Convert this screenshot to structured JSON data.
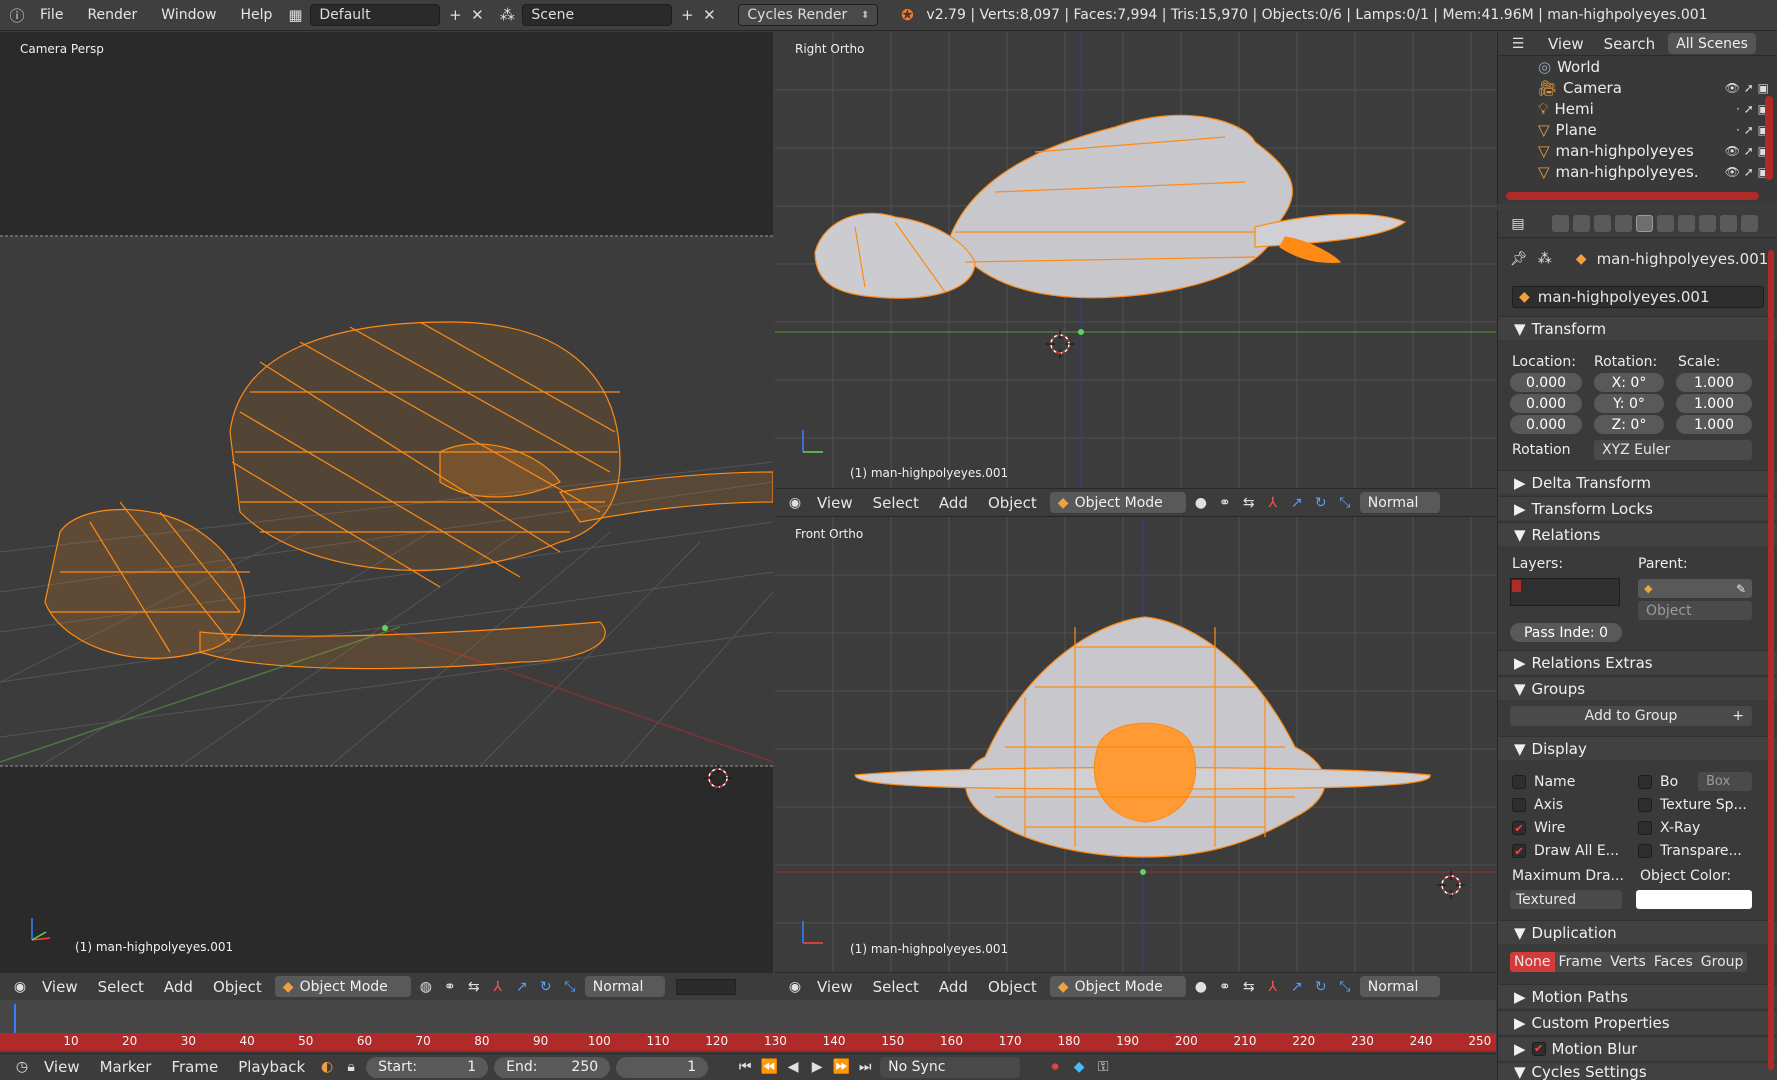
{
  "topbar": {
    "menus": [
      "File",
      "Render",
      "Window",
      "Help"
    ],
    "layout": "Default",
    "scene": "Scene",
    "engine": "Cycles Render",
    "stats": "v2.79 | Verts:8,097 | Faces:7,994 | Tris:15,970 | Objects:0/6 | Lamps:0/1 | Mem:41.96M | man-highpolyeyes.001"
  },
  "viewports": {
    "camera": {
      "label": "Camera Persp",
      "object": "(1) man-highpolyeyes.001"
    },
    "right": {
      "label": "Right Ortho",
      "object": "(1) man-highpolyeyes.001"
    },
    "front": {
      "label": "Front Ortho",
      "object": "(1) man-highpolyeyes.001"
    }
  },
  "vp_header": {
    "view": "View",
    "select": "Select",
    "add": "Add",
    "object": "Object",
    "mode": "Object Mode",
    "orientation": "Normal"
  },
  "timeline": {
    "ticks": [
      "10",
      "20",
      "30",
      "40",
      "50",
      "60",
      "70",
      "80",
      "90",
      "100",
      "110",
      "120",
      "130",
      "140",
      "150",
      "160",
      "170",
      "180",
      "190",
      "200",
      "210",
      "220",
      "230",
      "240",
      "250"
    ],
    "menus": [
      "View",
      "Marker",
      "Frame",
      "Playback"
    ],
    "start_label": "Start:",
    "start": "1",
    "end_label": "End:",
    "end": "250",
    "current": "1",
    "sync": "No Sync"
  },
  "outliner": {
    "tabs": [
      "View",
      "Search",
      "All Scenes"
    ],
    "items": [
      {
        "name": "World",
        "icon": "world-icon"
      },
      {
        "name": "Camera",
        "icon": "camera-icon"
      },
      {
        "name": "Hemi",
        "icon": "lamp-icon"
      },
      {
        "name": "Plane",
        "icon": "mesh-icon"
      },
      {
        "name": "man-highpolyeyes",
        "icon": "mesh-icon"
      },
      {
        "name": "man-highpolyeyes.",
        "icon": "mesh-icon"
      }
    ]
  },
  "properties": {
    "context_object": "man-highpolyeyes.001",
    "object_name": "man-highpolyeyes.001",
    "transform": {
      "title": "Transform",
      "location_label": "Location:",
      "rotation_label": "Rotation:",
      "scale_label": "Scale:",
      "location": [
        "0.000",
        "0.000",
        "0.000"
      ],
      "rotation": [
        "X:   0°",
        "Y:   0°",
        "Z:   0°"
      ],
      "scale": [
        "1.000",
        "1.000",
        "1.000"
      ],
      "rotation_mode_label": "Rotation",
      "rotation_mode": "XYZ Euler"
    },
    "delta_transform": "Delta Transform",
    "transform_locks": "Transform Locks",
    "relations": {
      "title": "Relations",
      "layers_label": "Layers:",
      "parent_label": "Parent:",
      "parent_type": "Object",
      "pass_index": "Pass Inde: 0"
    },
    "relations_extras": "Relations Extras",
    "groups": {
      "title": "Groups",
      "add": "Add to Group"
    },
    "display": {
      "title": "Display",
      "name": "Name",
      "bo": "Bo",
      "box": "Box",
      "axis": "Axis",
      "texture_space": "Texture Sp...",
      "wire": "Wire",
      "xray": "X-Ray",
      "draw_all_edges": "Draw All E...",
      "transparency": "Transpare...",
      "max_draw_label": "Maximum Dra...",
      "object_color_label": "Object Color:",
      "max_draw": "Textured"
    },
    "duplication": {
      "title": "Duplication",
      "options": [
        "None",
        "Frame",
        "Verts",
        "Faces",
        "Group"
      ]
    },
    "motion_paths": "Motion Paths",
    "custom_properties": "Custom Properties",
    "motion_blur": "Motion Blur",
    "cycles_settings": "Cycles Settings"
  },
  "colors": {
    "accent": "#ff8a14",
    "selected_red": "#d33a3a",
    "ruler": "#b02a2a"
  }
}
